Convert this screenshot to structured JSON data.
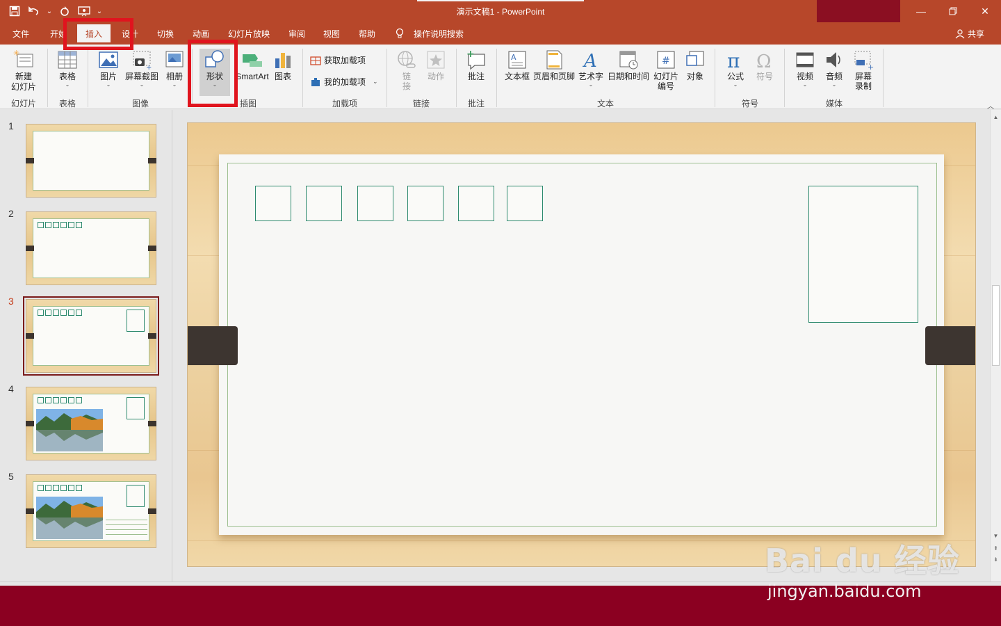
{
  "titlebar": {
    "doc_title": "演示文稿1  -  PowerPoint",
    "qat": [
      "save-icon",
      "undo-icon",
      "redo-icon",
      "present-icon",
      "customize-icon"
    ]
  },
  "window_controls": [
    "minimize-icon",
    "restore-icon",
    "close-icon"
  ],
  "tabs": [
    {
      "label": "文件"
    },
    {
      "label": "开始"
    },
    {
      "label": "插入",
      "active": true
    },
    {
      "label": "设计"
    },
    {
      "label": "切换"
    },
    {
      "label": "动画"
    },
    {
      "label": "幻灯片放映"
    },
    {
      "label": "审阅"
    },
    {
      "label": "视图"
    },
    {
      "label": "帮助"
    }
  ],
  "tell_me": "操作说明搜索",
  "share": "共享",
  "ribbon": {
    "slides": {
      "new_slide": "新建\n幻灯片",
      "group": "幻灯片"
    },
    "tables": {
      "table": "表格",
      "group": "表格"
    },
    "images": {
      "picture": "图片",
      "screenshot": "屏幕截图",
      "album": "相册",
      "group": "图像"
    },
    "illustrations": {
      "shapes": "形状",
      "smartart": "SmartArt",
      "chart": "图表",
      "group": "插图"
    },
    "addins": {
      "get": "获取加载项",
      "mine": "我的加载项",
      "group": "加载项"
    },
    "links": {
      "link": "链\n接",
      "action": "动作",
      "group": "链接"
    },
    "comments": {
      "comment": "批注",
      "group": "批注"
    },
    "text": {
      "textbox": "文本框",
      "header_footer": "页眉和页脚",
      "wordart": "艺术字",
      "datetime": "日期和时间",
      "slide_number": "幻灯片\n编号",
      "object": "对象",
      "group": "文本"
    },
    "symbols": {
      "equation": "公式",
      "symbol": "符号",
      "group": "符号"
    },
    "media": {
      "video": "视频",
      "audio": "音频",
      "screen_record": "屏幕\n录制",
      "group": "媒体"
    }
  },
  "slides": [
    {
      "num": "1"
    },
    {
      "num": "2"
    },
    {
      "num": "3",
      "current": true
    },
    {
      "num": "4"
    },
    {
      "num": "5"
    }
  ],
  "watermark": {
    "brand": "Bai du 经验",
    "url": "jingyan.baidu.com"
  },
  "colors": {
    "accent": "#b7472a",
    "highlight": "#e0141e",
    "statusbar": "#8b0021",
    "envelope_line": "#2e8a6e"
  }
}
